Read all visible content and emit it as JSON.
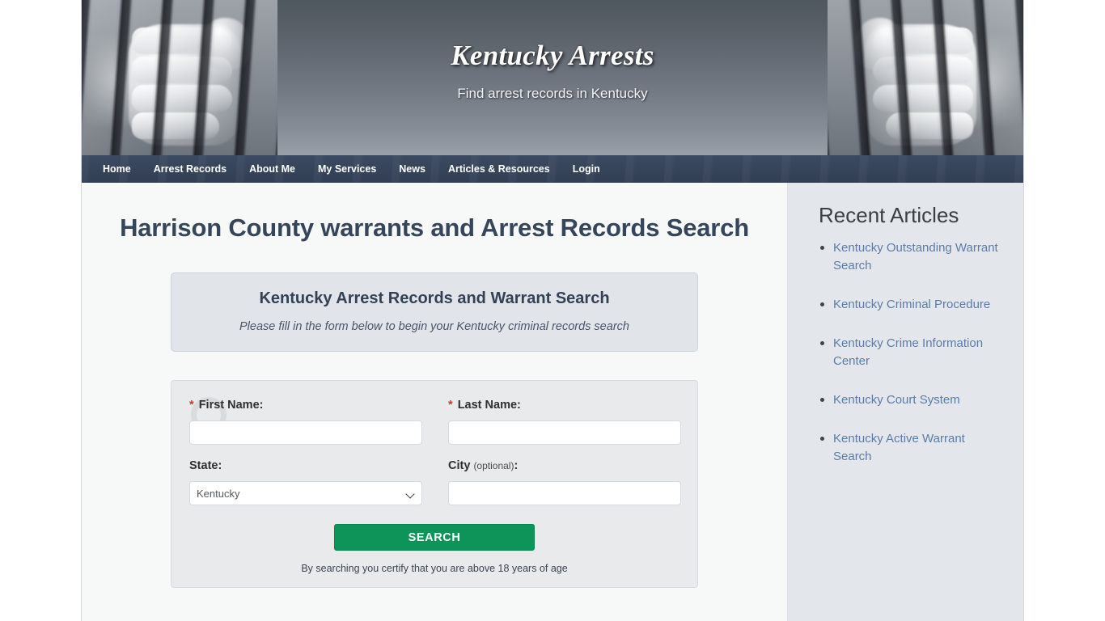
{
  "site": {
    "title": "Kentucky Arrests",
    "tagline": "Find arrest records in Kentucky"
  },
  "nav": {
    "items": [
      {
        "label": "Home",
        "name": "nav-home"
      },
      {
        "label": "Arrest Records",
        "name": "nav-arrest-records"
      },
      {
        "label": "About Me",
        "name": "nav-about-me"
      },
      {
        "label": "My Services",
        "name": "nav-my-services"
      },
      {
        "label": "News",
        "name": "nav-news"
      },
      {
        "label": "Articles & Resources",
        "name": "nav-articles-resources"
      },
      {
        "label": "Login",
        "name": "nav-login"
      }
    ]
  },
  "main": {
    "page_title": "Harrison County warrants and Arrest Records Search",
    "callout": {
      "title": "Kentucky Arrest Records and Warrant Search",
      "subtitle": "Please fill in the form below to begin your Kentucky criminal records search"
    },
    "form": {
      "first_name": {
        "label": "First Name:",
        "required_mark": "*",
        "value": "",
        "placeholder": ""
      },
      "last_name": {
        "label": "Last Name:",
        "required_mark": "*",
        "value": "",
        "placeholder": ""
      },
      "state": {
        "label": "State:",
        "selected": "Kentucky",
        "options": [
          "Kentucky"
        ]
      },
      "city": {
        "label": "City",
        "optional_text": "(optional)",
        "label_suffix": ":",
        "value": "",
        "placeholder": ""
      },
      "submit_label": "SEARCH",
      "note": "By searching you certify that you are above 18 years of age",
      "watermark_icon": "magnifier-icon"
    }
  },
  "sidebar": {
    "title": "Recent Articles",
    "articles": [
      {
        "label": "Kentucky Outstanding Warrant Search"
      },
      {
        "label": "Kentucky Criminal Procedure"
      },
      {
        "label": "Kentucky Crime Information Center"
      },
      {
        "label": "Kentucky Court System"
      },
      {
        "label": "Kentucky Active Warrant Search"
      }
    ]
  },
  "colors": {
    "nav_bar": "#36445a",
    "heading": "#36465a",
    "link": "#5b7ca7",
    "button_green": "#0e9358",
    "required_red": "#cf3434",
    "sidebar_bg": "#e3e7ec",
    "main_bg": "#f7f8f8",
    "form_panel_bg": "#e8eaec",
    "callout_bg": "#e1e5ea"
  }
}
